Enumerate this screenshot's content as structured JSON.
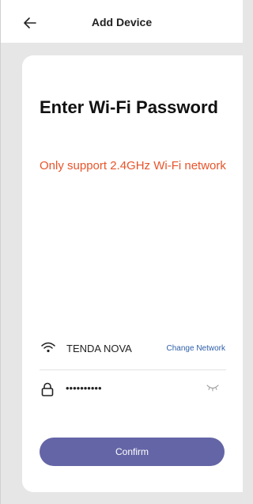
{
  "header": {
    "title": "Add Device",
    "back_icon": "arrow-left-icon"
  },
  "card": {
    "heading": "Enter Wi-Fi Password",
    "warning": "Only support 2.4GHz Wi-Fi network"
  },
  "network": {
    "icon": "wifi-icon",
    "ssid": "TENDA NOVA",
    "change_label": "Change Network"
  },
  "password": {
    "icon": "lock-icon",
    "value": "••••••••••",
    "visibility_icon": "eye-closed-icon"
  },
  "confirm_label": "Confirm",
  "colors": {
    "accent": "#6465a6",
    "warning": "#e8542a",
    "link": "#2e5fa8",
    "background": "#e6e6e6"
  }
}
